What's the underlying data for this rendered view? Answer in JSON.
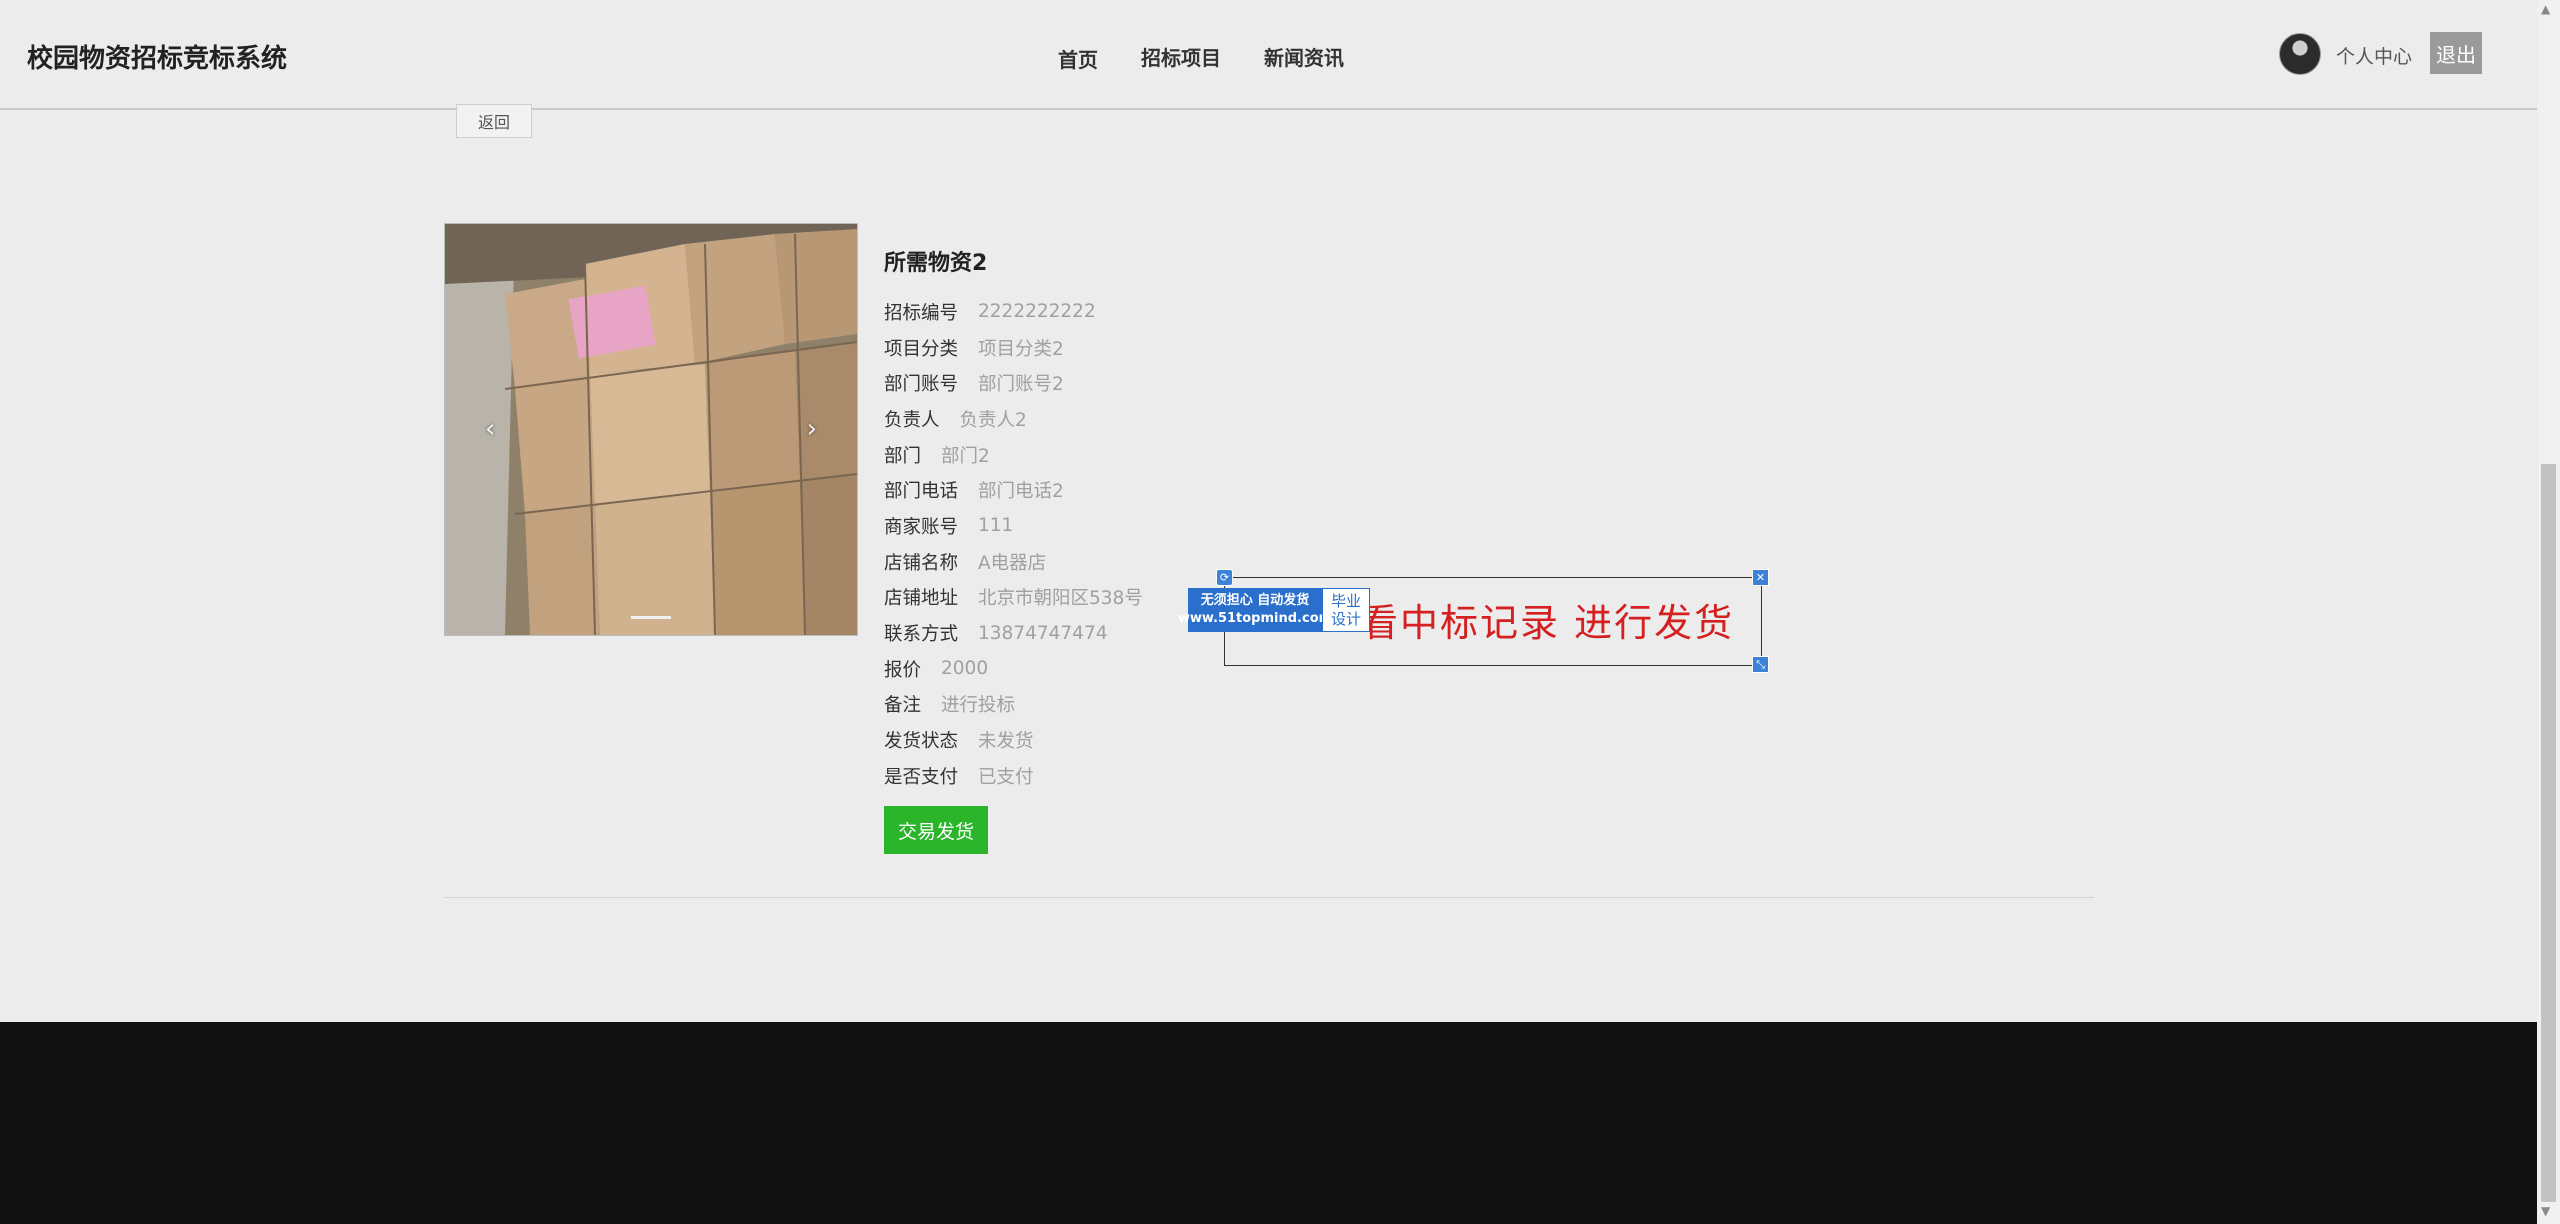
{
  "header": {
    "brand": "校园物资招标竞标系统",
    "nav": [
      "首页",
      "招标项目",
      "新闻资讯"
    ],
    "profile": "个人中心",
    "logout": "退出"
  },
  "back_label": "返回",
  "item": {
    "title": "所需物资2",
    "fields": [
      {
        "label": "招标编号",
        "value": "2222222222"
      },
      {
        "label": "项目分类",
        "value": "项目分类2"
      },
      {
        "label": "部门账号",
        "value": "部门账号2"
      },
      {
        "label": "负责人",
        "value": "负责人2"
      },
      {
        "label": "部门",
        "value": "部门2"
      },
      {
        "label": "部门电话",
        "value": "部门电话2"
      },
      {
        "label": "商家账号",
        "value": "111"
      },
      {
        "label": "店铺名称",
        "value": "A电器店"
      },
      {
        "label": "店铺地址",
        "value": "北京市朝阳区538号"
      },
      {
        "label": "联系方式",
        "value": "13874747474"
      },
      {
        "label": "报价",
        "value": "2000"
      },
      {
        "label": "备注",
        "value": "进行投标"
      },
      {
        "label": "发货状态",
        "value": "未发货"
      },
      {
        "label": "是否支付",
        "value": "已支付"
      }
    ],
    "ship_button": "交易发货"
  },
  "overlay": {
    "text": "看中标记录 进行发货",
    "watermark_line1": "无须担心 自动发货",
    "watermark_line2": "www.51topmind.com",
    "watermark_tag1": "毕业",
    "watermark_tag2": "设计"
  },
  "icons": {
    "carousel_prev": "‹",
    "carousel_next": "›",
    "close": "✕",
    "rotate": "⟳",
    "resize": "⤡",
    "scroll_up": "▲",
    "scroll_down": "▼"
  },
  "colors": {
    "accent_green": "#2bb52b",
    "overlay_text": "#d42020",
    "handle_blue": "#3c82d8"
  }
}
